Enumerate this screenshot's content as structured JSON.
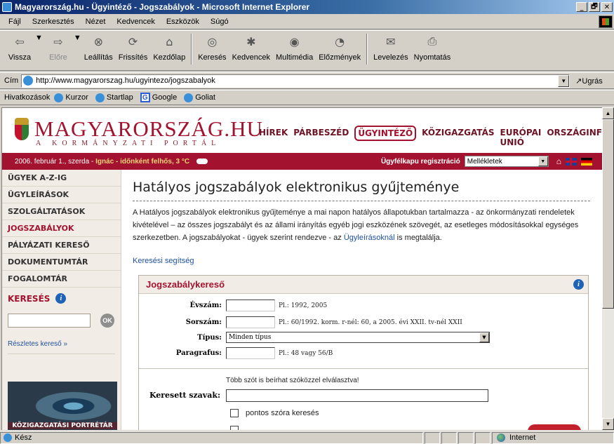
{
  "window": {
    "title": "Magyarország.hu - Ügyintéző - Jogszabályok - Microsoft Internet Explorer",
    "btn_min": "_",
    "btn_max": "🗗",
    "btn_close": "✕"
  },
  "menu": [
    "Fájl",
    "Szerkesztés",
    "Nézet",
    "Kedvencek",
    "Eszközök",
    "Súgó"
  ],
  "toolbar": {
    "back": "Vissza",
    "forward": "Előre",
    "stop": "Leállítás",
    "refresh": "Frissítés",
    "home": "Kezdőlap",
    "search": "Keresés",
    "favorites": "Kedvencek",
    "media": "Multimédia",
    "history": "Előzmények",
    "mail": "Levelezés",
    "print": "Nyomtatás"
  },
  "address": {
    "label": "Cím",
    "url": "http://www.magyarorszag.hu/ugyintezo/jogszabalyok",
    "go": "Ugrás"
  },
  "links": {
    "label": "Hivatkozások",
    "items": [
      "Kurzor",
      "Startlap",
      "Google",
      "Goliat"
    ]
  },
  "site": {
    "brand": "MAGYARORSZÁG.HU",
    "brand_sub": "A KORMÁNYZATI PORTÁL",
    "topnav": [
      "HÍREK",
      "PÁRBESZÉD",
      "ÜGYINTÉZŐ",
      "KÖZIGAZGATÁS",
      "EURÓPAI UNIÓ",
      "ORSZÁGINFÓ"
    ],
    "active_topnav": "ÜGYINTÉZŐ"
  },
  "infobar": {
    "date_prefix": "2006. február 1., szerda - ",
    "nameday": "Ignác",
    "weather": " - időnként felhős, 3 °C",
    "registration": "Ügyfélkapu regisztráció",
    "select_value": "Mellékletek",
    "dd": "▼"
  },
  "sidebar": {
    "items": [
      "ÜGYEK A-Z-IG",
      "ÜGYLEÍRÁSOK",
      "SZOLGÁLTATÁSOK",
      "JOGSZABÁLYOK",
      "PÁLYÁZATI KERESŐ",
      "DOKUMENTUMTÁR",
      "FOGALOMTÁR"
    ],
    "active": "JOGSZABÁLYOK",
    "search_title": "KERESÉS",
    "ok": "OK",
    "advanced": "Részletes kereső »",
    "banner": "KÖZIGAZGATÁSI PORTRÉTÁR"
  },
  "main": {
    "heading": "Hatályos jogszabályok elektronikus gyűjteménye",
    "intro": "A Hatályos jogszabályok elektronikus gyűjteménye a mai napon hatályos állapotukban tartalmazza - az önkormányzati rendeletek kivételével – az összes jogszabályt és az állami irányítás egyéb jogi eszközének szövegét, az esetleges módosításokkal egységes szerkezetben. A jogszabályokat - ügyek szerint rendezve - az ",
    "intro_link": "Ügyleírásoknál",
    "intro_end": " is megtalálja.",
    "help": "Keresési segítség",
    "box_title": "Jogszabálykereső",
    "fields": {
      "year_label": "Évszám:",
      "year_hint": "Pl.: 1992, 2005",
      "number_label": "Sorszám:",
      "number_hint": "Pl.: 60/1992. korm. r-nél: 60, a 2005. évi XXII. tv-nél XXII",
      "type_label": "Típus:",
      "type_value": "Minden típus",
      "para_label": "Paragrafus:",
      "para_hint": "Pl.: 48 vagy 56/B"
    },
    "words_note": "Több szót is beírhat szóközzel elválasztva!",
    "words_label": "Keresett szavak:",
    "exact": "pontos szóra keresés"
  },
  "status": {
    "text": "Kész",
    "zone": "Internet"
  }
}
